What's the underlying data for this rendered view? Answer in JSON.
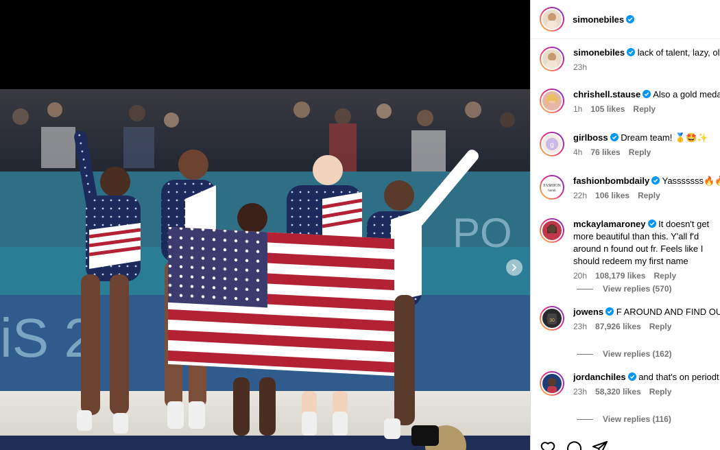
{
  "post": {
    "author": "simonebiles",
    "photo_alt": "Team USA gymnasts celebrating with American flag",
    "colors": {
      "verified": "#0095f6",
      "leotard": "#1c2a5c",
      "flag_red": "#b22234",
      "flag_blue": "#3c3b6e"
    }
  },
  "caption": {
    "username": "simonebiles",
    "text": "lack of talent, lazy, olympic champions",
    "time": "23h"
  },
  "comments": [
    {
      "username": "chrishell.stause",
      "text": "Also a gold medalist in petty",
      "time": "1h",
      "likes": "105 likes",
      "reply": "Reply",
      "avatar": "blonde-woman-avatar"
    },
    {
      "username": "girlboss",
      "text": "Dream team! 🥇🤩✨",
      "time": "4h",
      "likes": "76 likes",
      "reply": "Reply",
      "avatar": "girlboss-logo-avatar"
    },
    {
      "username": "fashionbombdaily",
      "text": "Yasssssss🔥🔥🔥",
      "time": "22h",
      "likes": "106 likes",
      "reply": "Reply",
      "avatar": "fashion-bomb-logo-avatar"
    },
    {
      "username": "mckaylamaroney",
      "text": "It doesn't get more beautiful than this. Y'all f'd around n found out fr. Feels like I should redeem my first name",
      "time": "20h",
      "likes": "108,179 likes",
      "reply": "Reply",
      "view_replies": "View replies (570)",
      "avatar": "woman-red-avatar"
    },
    {
      "username": "jowens",
      "text": "F AROUND AND FIND OUT",
      "time": "23h",
      "likes": "87,926 likes",
      "reply": "Reply",
      "view_replies": "View replies (162)",
      "avatar": "jersey-avatar"
    },
    {
      "username": "jordanchiles",
      "text": "and that's on periodt",
      "time": "23h",
      "likes": "58,320 likes",
      "reply": "Reply",
      "view_replies": "View replies (116)",
      "avatar": "woman-dark-avatar"
    }
  ],
  "actions": [
    "heart-icon",
    "comment-icon",
    "share-icon"
  ]
}
